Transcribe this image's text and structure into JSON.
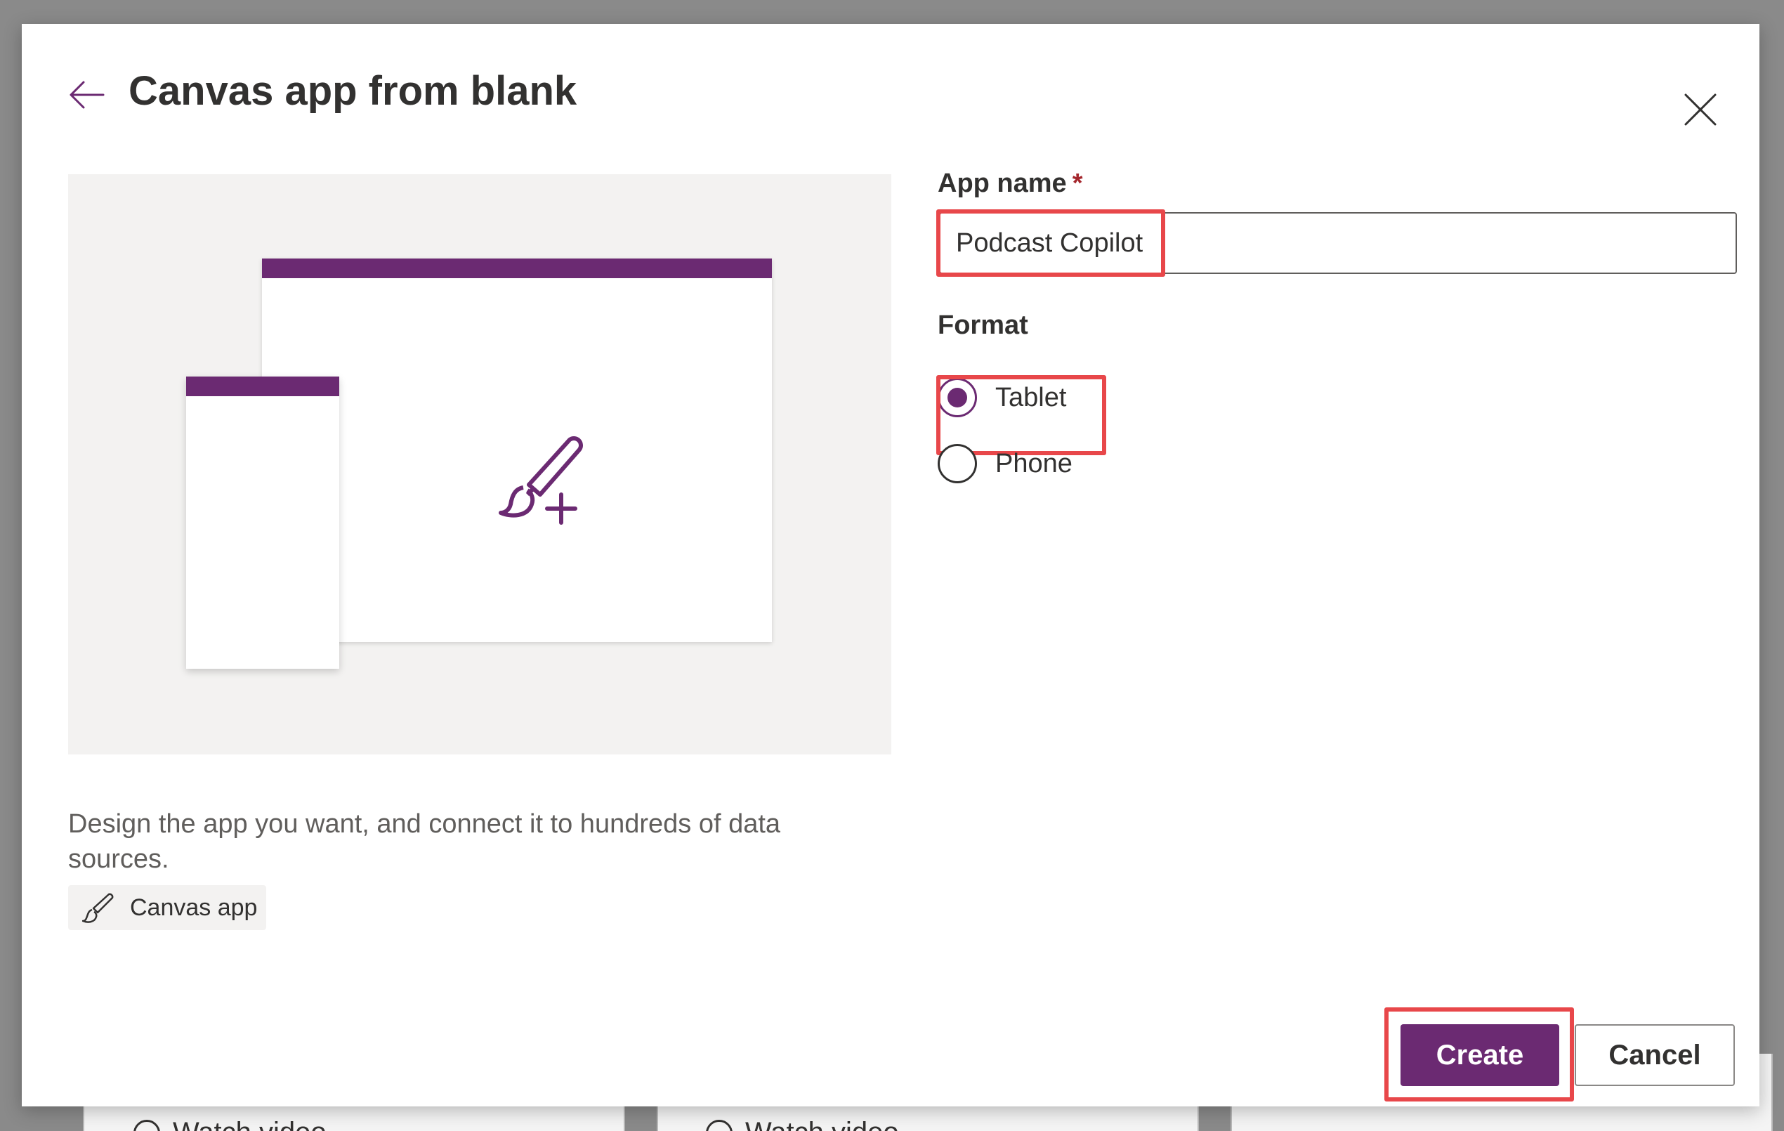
{
  "dialog": {
    "title": "Canvas app from blank"
  },
  "preview": {
    "description": "Design the app you want, and connect it to hundreds of data sources.",
    "tag_label": "Canvas app"
  },
  "form": {
    "app_name_label": "App name",
    "required_mark": "*",
    "app_name_value": "Podcast Copilot",
    "format_label": "Format",
    "format_options": [
      {
        "label": "Tablet",
        "selected": true
      },
      {
        "label": "Phone",
        "selected": false
      }
    ]
  },
  "footer": {
    "create_label": "Create",
    "cancel_label": "Cancel"
  },
  "background": {
    "watch_video_1": "Watch video",
    "watch_video_2": "Watch video"
  },
  "colors": {
    "accent": "#6b2a72",
    "highlight": "#e8474a",
    "preview_bg": "#f3f2f1"
  },
  "icons": {
    "back": "back-arrow-icon",
    "close": "close-icon",
    "illustration": "paintbrush-plus-icon",
    "tag": "paintbrush-icon",
    "play": "play-circle-icon"
  }
}
